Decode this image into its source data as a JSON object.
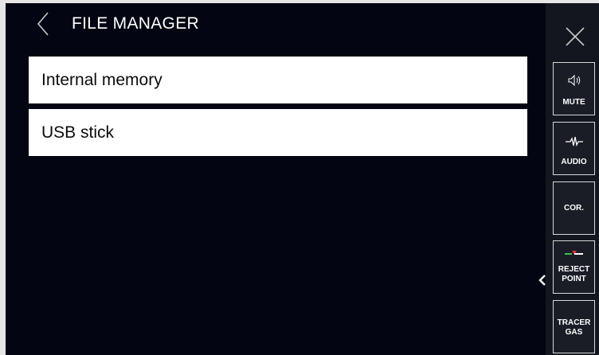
{
  "header": {
    "title": "FILE MANAGER",
    "back_icon": "chevron-left-icon"
  },
  "storage_list": [
    {
      "label": "Internal memory"
    },
    {
      "label": "USB stick"
    }
  ],
  "sidebar": {
    "close_icon": "close-icon",
    "collapse_icon": "chevron-left-icon",
    "buttons": [
      {
        "label": "MUTE",
        "icon": "speaker-icon"
      },
      {
        "label": "AUDIO",
        "icon": "waveform-icon"
      },
      {
        "label": "COR.",
        "icon": ""
      },
      {
        "label_line1": "REJECT",
        "label_line2": "POINT",
        "icon": "reject-point-icon"
      },
      {
        "label_line1": "TRACER",
        "label_line2": "GAS",
        "icon": ""
      }
    ]
  },
  "colors": {
    "background": "#030612",
    "sidebar": "#13161e",
    "list_item": "#ffffff",
    "text_light": "#ffffff",
    "text_dark": "#0c0c0c",
    "reject_green": "#3cc24a",
    "reject_red": "#e0303a"
  }
}
